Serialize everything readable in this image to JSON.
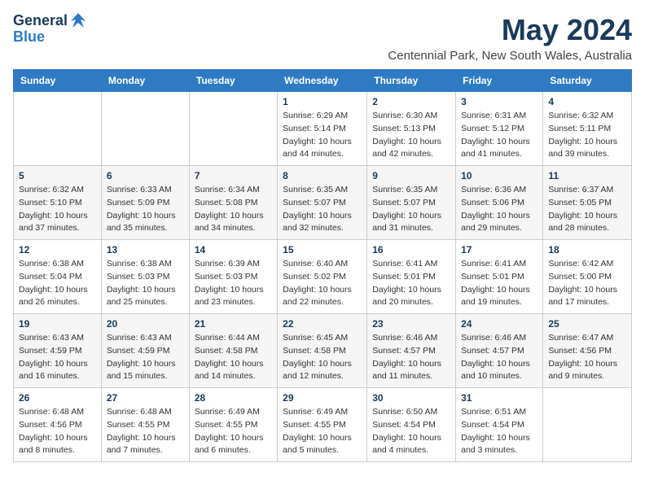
{
  "logo": {
    "line1": "General",
    "line2": "Blue"
  },
  "title": "May 2024",
  "subtitle": "Centennial Park, New South Wales, Australia",
  "days_of_week": [
    "Sunday",
    "Monday",
    "Tuesday",
    "Wednesday",
    "Thursday",
    "Friday",
    "Saturday"
  ],
  "weeks": [
    [
      {
        "day": "",
        "info": ""
      },
      {
        "day": "",
        "info": ""
      },
      {
        "day": "",
        "info": ""
      },
      {
        "day": "1",
        "info": "Sunrise: 6:29 AM\nSunset: 5:14 PM\nDaylight: 10 hours\nand 44 minutes."
      },
      {
        "day": "2",
        "info": "Sunrise: 6:30 AM\nSunset: 5:13 PM\nDaylight: 10 hours\nand 42 minutes."
      },
      {
        "day": "3",
        "info": "Sunrise: 6:31 AM\nSunset: 5:12 PM\nDaylight: 10 hours\nand 41 minutes."
      },
      {
        "day": "4",
        "info": "Sunrise: 6:32 AM\nSunset: 5:11 PM\nDaylight: 10 hours\nand 39 minutes."
      }
    ],
    [
      {
        "day": "5",
        "info": "Sunrise: 6:32 AM\nSunset: 5:10 PM\nDaylight: 10 hours\nand 37 minutes."
      },
      {
        "day": "6",
        "info": "Sunrise: 6:33 AM\nSunset: 5:09 PM\nDaylight: 10 hours\nand 35 minutes."
      },
      {
        "day": "7",
        "info": "Sunrise: 6:34 AM\nSunset: 5:08 PM\nDaylight: 10 hours\nand 34 minutes."
      },
      {
        "day": "8",
        "info": "Sunrise: 6:35 AM\nSunset: 5:07 PM\nDaylight: 10 hours\nand 32 minutes."
      },
      {
        "day": "9",
        "info": "Sunrise: 6:35 AM\nSunset: 5:07 PM\nDaylight: 10 hours\nand 31 minutes."
      },
      {
        "day": "10",
        "info": "Sunrise: 6:36 AM\nSunset: 5:06 PM\nDaylight: 10 hours\nand 29 minutes."
      },
      {
        "day": "11",
        "info": "Sunrise: 6:37 AM\nSunset: 5:05 PM\nDaylight: 10 hours\nand 28 minutes."
      }
    ],
    [
      {
        "day": "12",
        "info": "Sunrise: 6:38 AM\nSunset: 5:04 PM\nDaylight: 10 hours\nand 26 minutes."
      },
      {
        "day": "13",
        "info": "Sunrise: 6:38 AM\nSunset: 5:03 PM\nDaylight: 10 hours\nand 25 minutes."
      },
      {
        "day": "14",
        "info": "Sunrise: 6:39 AM\nSunset: 5:03 PM\nDaylight: 10 hours\nand 23 minutes."
      },
      {
        "day": "15",
        "info": "Sunrise: 6:40 AM\nSunset: 5:02 PM\nDaylight: 10 hours\nand 22 minutes."
      },
      {
        "day": "16",
        "info": "Sunrise: 6:41 AM\nSunset: 5:01 PM\nDaylight: 10 hours\nand 20 minutes."
      },
      {
        "day": "17",
        "info": "Sunrise: 6:41 AM\nSunset: 5:01 PM\nDaylight: 10 hours\nand 19 minutes."
      },
      {
        "day": "18",
        "info": "Sunrise: 6:42 AM\nSunset: 5:00 PM\nDaylight: 10 hours\nand 17 minutes."
      }
    ],
    [
      {
        "day": "19",
        "info": "Sunrise: 6:43 AM\nSunset: 4:59 PM\nDaylight: 10 hours\nand 16 minutes."
      },
      {
        "day": "20",
        "info": "Sunrise: 6:43 AM\nSunset: 4:59 PM\nDaylight: 10 hours\nand 15 minutes."
      },
      {
        "day": "21",
        "info": "Sunrise: 6:44 AM\nSunset: 4:58 PM\nDaylight: 10 hours\nand 14 minutes."
      },
      {
        "day": "22",
        "info": "Sunrise: 6:45 AM\nSunset: 4:58 PM\nDaylight: 10 hours\nand 12 minutes."
      },
      {
        "day": "23",
        "info": "Sunrise: 6:46 AM\nSunset: 4:57 PM\nDaylight: 10 hours\nand 11 minutes."
      },
      {
        "day": "24",
        "info": "Sunrise: 6:46 AM\nSunset: 4:57 PM\nDaylight: 10 hours\nand 10 minutes."
      },
      {
        "day": "25",
        "info": "Sunrise: 6:47 AM\nSunset: 4:56 PM\nDaylight: 10 hours\nand 9 minutes."
      }
    ],
    [
      {
        "day": "26",
        "info": "Sunrise: 6:48 AM\nSunset: 4:56 PM\nDaylight: 10 hours\nand 8 minutes."
      },
      {
        "day": "27",
        "info": "Sunrise: 6:48 AM\nSunset: 4:55 PM\nDaylight: 10 hours\nand 7 minutes."
      },
      {
        "day": "28",
        "info": "Sunrise: 6:49 AM\nSunset: 4:55 PM\nDaylight: 10 hours\nand 6 minutes."
      },
      {
        "day": "29",
        "info": "Sunrise: 6:49 AM\nSunset: 4:55 PM\nDaylight: 10 hours\nand 5 minutes."
      },
      {
        "day": "30",
        "info": "Sunrise: 6:50 AM\nSunset: 4:54 PM\nDaylight: 10 hours\nand 4 minutes."
      },
      {
        "day": "31",
        "info": "Sunrise: 6:51 AM\nSunset: 4:54 PM\nDaylight: 10 hours\nand 3 minutes."
      },
      {
        "day": "",
        "info": ""
      }
    ]
  ]
}
